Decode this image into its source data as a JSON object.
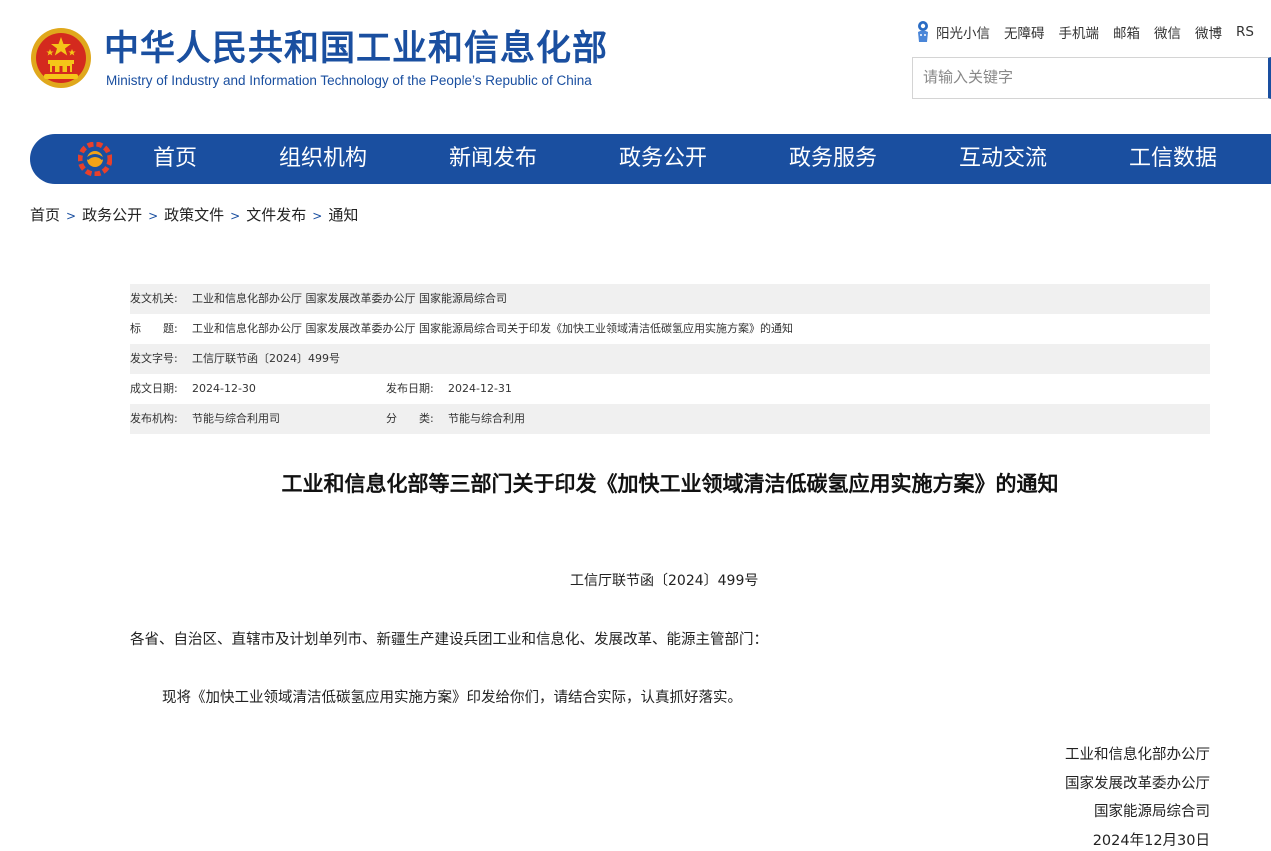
{
  "header": {
    "title_cn": "中华人民共和国工业和信息化部",
    "title_en": "Ministry of Industry and Information Technology of the People’s Republic of China",
    "top_links": [
      "阳光小信",
      "无障碍",
      "手机端",
      "邮箱",
      "微信",
      "微博",
      "RS"
    ],
    "search_placeholder": "请输入关键字"
  },
  "nav": {
    "items": [
      "首页",
      "组织机构",
      "新闻发布",
      "政务公开",
      "政务服务",
      "互动交流",
      "工信数据"
    ]
  },
  "breadcrumb": [
    "首页",
    "政务公开",
    "政策文件",
    "文件发布",
    "通知"
  ],
  "breadcrumb_separator": ">",
  "meta": {
    "issuer_label": "发文机关:",
    "issuer": "工业和信息化部办公厅 国家发展改革委办公厅 国家能源局综合司",
    "title_label": "标　　题:",
    "title": "工业和信息化部办公厅 国家发展改革委办公厅 国家能源局综合司关于印发《加快工业领域清洁低碳氢应用实施方案》的通知",
    "docnum_label": "发文字号:",
    "docnum": "工信厅联节函〔2024〕499号",
    "created_label": "成文日期:",
    "created": "2024-12-30",
    "published_label": "发布日期:",
    "published": "2024-12-31",
    "org_label": "发布机构:",
    "org": "节能与综合利用司",
    "category_label": "分　　类:",
    "category": "节能与综合利用"
  },
  "article": {
    "title": "工业和信息化部等三部门关于印发《加快工业领域清洁低碳氢应用实施方案》的通知",
    "doc_number": "工信厅联节函〔2024〕499号",
    "addressee": "各省、自治区、直辖市及计划单列市、新疆生产建设兵团工业和信息化、发展改革、能源主管部门：",
    "body": "现将《加快工业领域清洁低碳氢应用实施方案》印发给你们，请结合实际，认真抓好落实。",
    "signatories": [
      "工业和信息化部办公厅",
      "国家发展改革委办公厅",
      "国家能源局综合司"
    ],
    "date": "2024年12月30日"
  },
  "colors": {
    "brand_blue": "#1a4fa0",
    "emblem_red": "#d42a1e",
    "emblem_gold": "#f5c518",
    "row_shade": "#f0f0f0"
  }
}
